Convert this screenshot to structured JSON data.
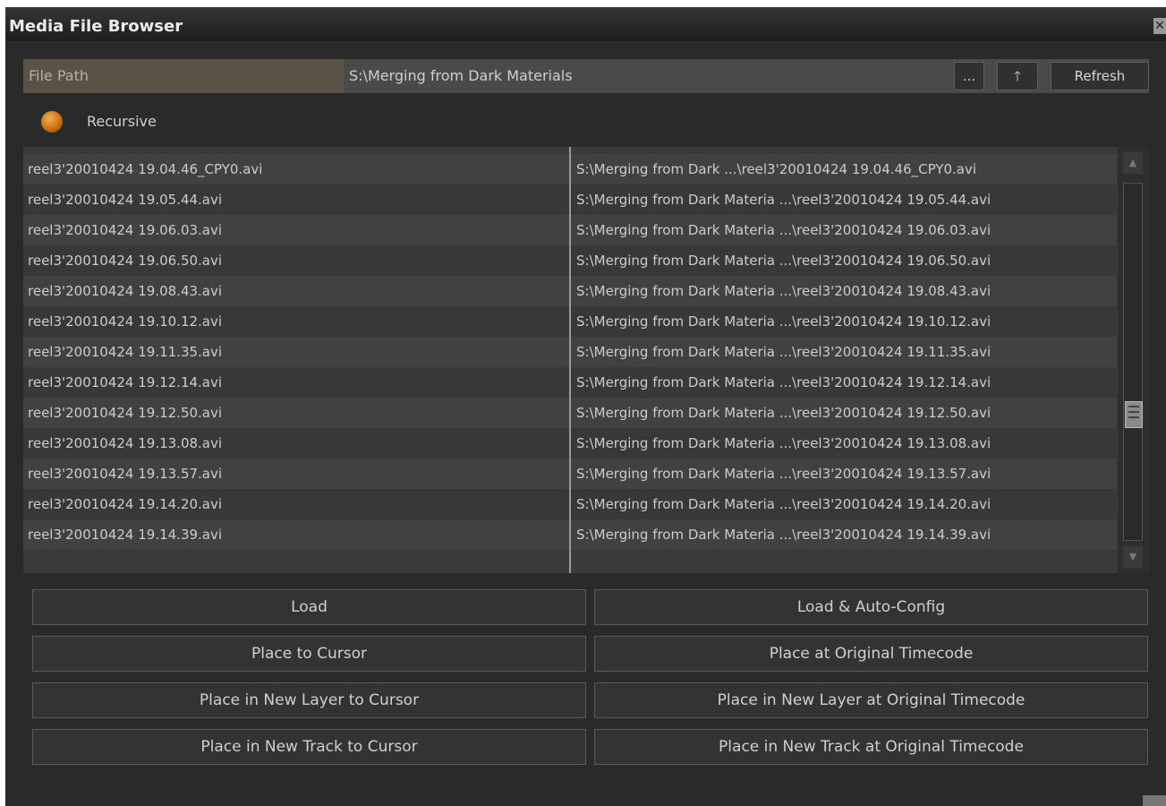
{
  "window": {
    "title": "Media File Browser",
    "close_glyph": "✕"
  },
  "path_bar": {
    "label": "File Path",
    "value": "S:\\Merging from Dark Materials",
    "browse_label": "...",
    "up_glyph": "🡑",
    "refresh_label": "Refresh"
  },
  "recursive": {
    "label": "Recursive",
    "on": true,
    "led_color": "#e08a24"
  },
  "files": [
    {
      "name": "reel3'20010424 19.04.46_CPY0.avi",
      "path": "S:\\Merging from Dark ...\\reel3'20010424 19.04.46_CPY0.avi"
    },
    {
      "name": "reel3'20010424 19.05.44.avi",
      "path": "S:\\Merging from Dark Materia ...\\reel3'20010424 19.05.44.avi"
    },
    {
      "name": "reel3'20010424 19.06.03.avi",
      "path": "S:\\Merging from Dark Materia ...\\reel3'20010424 19.06.03.avi"
    },
    {
      "name": "reel3'20010424 19.06.50.avi",
      "path": "S:\\Merging from Dark Materia ...\\reel3'20010424 19.06.50.avi"
    },
    {
      "name": "reel3'20010424 19.08.43.avi",
      "path": "S:\\Merging from Dark Materia ...\\reel3'20010424 19.08.43.avi"
    },
    {
      "name": "reel3'20010424 19.10.12.avi",
      "path": "S:\\Merging from Dark Materia ...\\reel3'20010424 19.10.12.avi"
    },
    {
      "name": "reel3'20010424 19.11.35.avi",
      "path": "S:\\Merging from Dark Materia ...\\reel3'20010424 19.11.35.avi"
    },
    {
      "name": "reel3'20010424 19.12.14.avi",
      "path": "S:\\Merging from Dark Materia ...\\reel3'20010424 19.12.14.avi"
    },
    {
      "name": "reel3'20010424 19.12.50.avi",
      "path": "S:\\Merging from Dark Materia ...\\reel3'20010424 19.12.50.avi"
    },
    {
      "name": "reel3'20010424 19.13.08.avi",
      "path": "S:\\Merging from Dark Materia ...\\reel3'20010424 19.13.08.avi"
    },
    {
      "name": "reel3'20010424 19.13.57.avi",
      "path": "S:\\Merging from Dark Materia ...\\reel3'20010424 19.13.57.avi"
    },
    {
      "name": "reel3'20010424 19.14.20.avi",
      "path": "S:\\Merging from Dark Materia ...\\reel3'20010424 19.14.20.avi"
    },
    {
      "name": "reel3'20010424 19.14.39.avi",
      "path": "S:\\Merging from Dark Materia ...\\reel3'20010424 19.14.39.avi"
    }
  ],
  "actions": {
    "load": "Load",
    "load_auto_config": "Load & Auto-Config",
    "place_to_cursor": "Place to Cursor",
    "place_at_original_timecode": "Place at Original Timecode",
    "place_new_layer_cursor": "Place in New Layer to Cursor",
    "place_new_layer_timecode": "Place in  New Layer at Original Timecode",
    "place_new_track_cursor": "Place in New Track to Cursor",
    "place_new_track_timecode": "Place in New Track at Original Timecode"
  },
  "scrollbar": {
    "up_glyph": "▲",
    "down_glyph": "▼",
    "position_fraction": 0.7
  }
}
